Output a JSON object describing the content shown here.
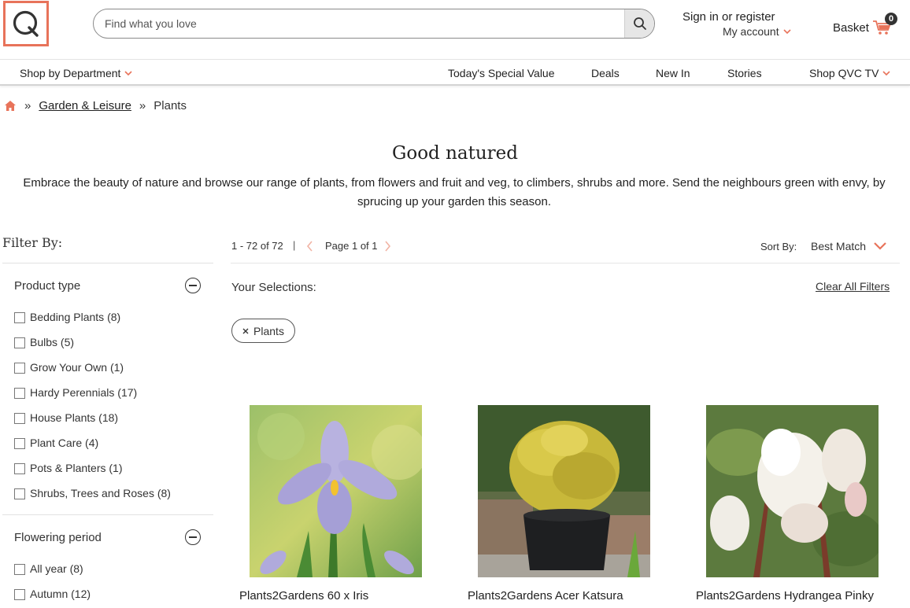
{
  "header": {
    "search_placeholder": "Find what you love",
    "signin_label": "Sign in or register",
    "myaccount_label": "My account",
    "basket_label": "Basket",
    "basket_count": "0"
  },
  "nav": {
    "shop_by_department": "Shop by Department",
    "tsv": "Today's Special Value",
    "deals": "Deals",
    "new_in": "New In",
    "stories": "Stories",
    "shop_tv": "Shop QVC TV"
  },
  "breadcrumb": {
    "sep": "»",
    "garden": "Garden & Leisure",
    "plants": "Plants"
  },
  "page": {
    "title": "Good natured",
    "description": "Embrace the beauty of nature and browse our range of plants, from flowers and fruit and veg, to climbers, shrubs and more. Send the neighbours green with envy, by sprucing up your garden this season."
  },
  "filters": {
    "heading": "Filter By:",
    "product_type": {
      "title": "Product type",
      "options": [
        "Bedding Plants (8)",
        "Bulbs (5)",
        "Grow Your Own (1)",
        "Hardy Perennials (17)",
        "House Plants (18)",
        "Plant Care (4)",
        "Pots & Planters (1)",
        "Shrubs, Trees and Roses (8)"
      ]
    },
    "flowering_period": {
      "title": "Flowering period",
      "options": [
        "All year (8)",
        "Autumn (12)"
      ]
    }
  },
  "results": {
    "count": "1 - 72 of 72",
    "pipe": "|",
    "page": "Page 1 of 1",
    "sort_label": "Sort By:",
    "sort_value": "Best Match",
    "selections_label": "Your Selections:",
    "clear_all": "Clear All Filters",
    "chip_label": "Plants"
  },
  "products": [
    "Plants2Gardens 60 x Iris",
    "Plants2Gardens Acer Katsura",
    "Plants2Gardens Hydrangea Pinky"
  ],
  "colors": {
    "accent": "#e8735a",
    "text": "#2b2b2b"
  }
}
